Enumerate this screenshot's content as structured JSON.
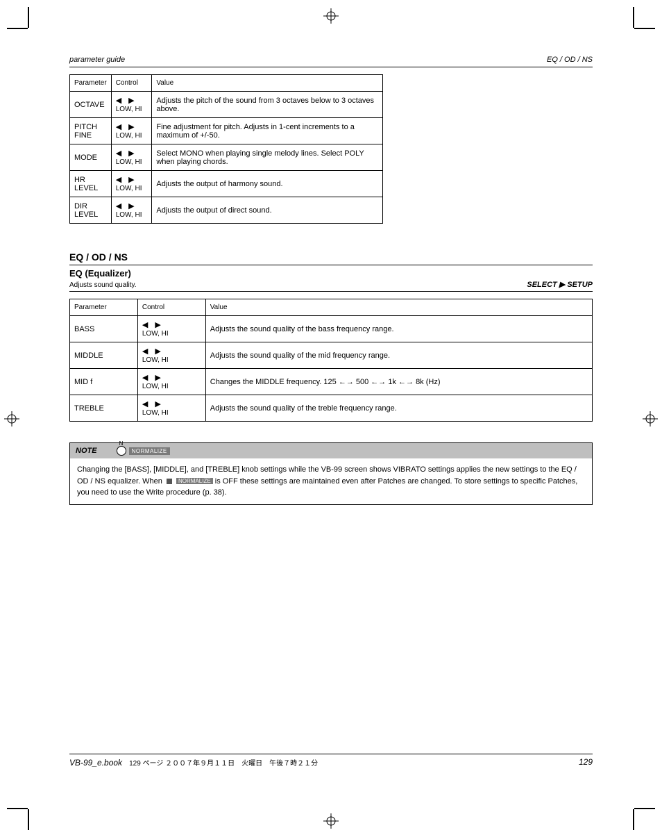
{
  "header": {
    "left": "parameter guide",
    "right": "EQ / OD / NS"
  },
  "table1": {
    "headers": [
      "Parameter",
      "Control",
      "Value"
    ],
    "rows": [
      {
        "param": "OCTAVE",
        "control_label": "LOW, HI",
        "value": "Adjusts the pitch of the sound from 3 octaves below to 3 octaves above."
      },
      {
        "param": "PITCH FINE",
        "control_label": "LOW, HI",
        "value": "Fine adjustment for pitch. Adjusts in 1-cent increments to a maximum of +/-50."
      },
      {
        "param": "MODE",
        "control_label": "LOW, HI",
        "value": "Select MONO when playing single melody lines. Select POLY when playing chords."
      },
      {
        "param": "HR LEVEL",
        "control_label": "LOW, HI",
        "value": "Adjusts the output of harmony sound."
      },
      {
        "param": "DIR LEVEL",
        "control_label": "LOW, HI",
        "value": "Adjusts the output of direct sound."
      }
    ]
  },
  "section": {
    "title": "EQ / OD / NS",
    "subtitle": "EQ (Equalizer)",
    "sub_desc": "Adjusts sound quality.",
    "sub_italic": "SELECT ▶ SETUP"
  },
  "table2": {
    "headers": [
      "Parameter",
      "Control",
      "Value"
    ],
    "rows": [
      {
        "param": "BASS",
        "value": "Adjusts the sound quality of the bass frequency range."
      },
      {
        "param": "MIDDLE",
        "value": "Adjusts the sound quality of the mid frequency range."
      },
      {
        "param": "MID f",
        "value": "Changes the MIDDLE frequency. 125 ←→ 500 ←→ 1k ←→ 8k (Hz)"
      },
      {
        "param": "TREBLE",
        "value": "Adjusts the sound quality of the treble frequency range."
      }
    ],
    "control_label": "LOW, HI"
  },
  "note": {
    "title_label": "NOTE",
    "chip": "NORMALIZE",
    "body_prefix": "Changing the [BASS], [MIDDLE], and [TREBLE] knob settings while the VB-99 screen shows VIBRATO settings applies the new settings to the EQ / OD / NS equalizer. When",
    "body_suffix": "is OFF these settings are maintained even after Patches are changed. To store settings to specific Patches, you need to use the Write procedure (p. 38)."
  },
  "footer": {
    "model": "VB-99_e.book",
    "pageinfo": "129 ページ  ２００７年９月１１日　火曜日　午後７時２１分",
    "pagenum": "129"
  }
}
